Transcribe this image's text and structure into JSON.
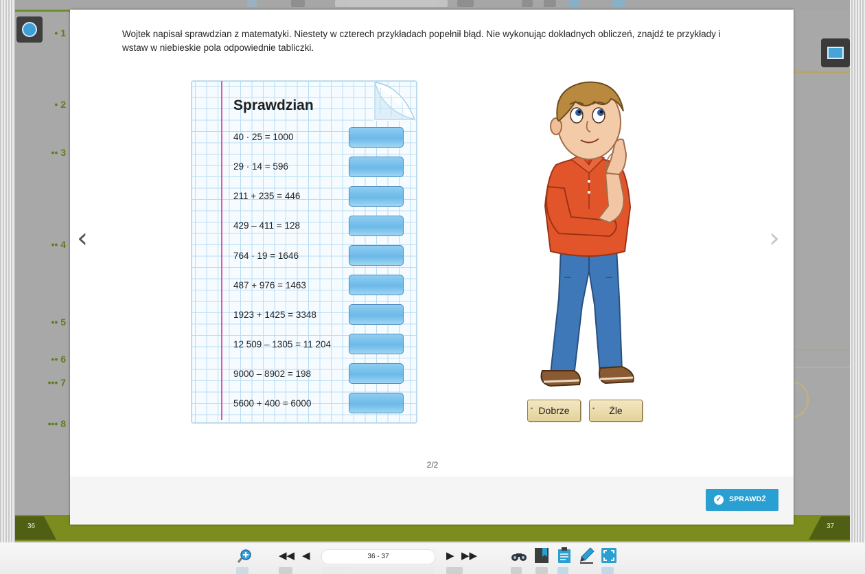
{
  "instruction": "Wojtek napisał sprawdzian z matematyki. Niestety w czterech przykładach popełnił błąd. Nie wykonując dokładnych obliczeń, znajdź te przykłady i wstaw w niebieskie pola odpowiednie tabliczki.",
  "sheet": {
    "title": "Sprawdzian",
    "equations": [
      "40 · 25 = 1000",
      "29 · 14 = 596",
      "211 + 235 = 446",
      "429 – 411 = 128",
      "764 · 19 = 1646",
      "487 + 976 = 1463",
      "1923 + 1425 = 3348",
      "12 509 – 1305 = 11 204",
      "9000 – 8902 = 198",
      "5600 + 400 = 6000"
    ]
  },
  "tiles": {
    "good": "Dobrze",
    "bad": "Źle"
  },
  "page_indicator": "2/2",
  "check_button": "SPRAWDŹ",
  "book": {
    "left_page": "36",
    "right_page": "37",
    "side_numbers": [
      "• 1",
      "• 2",
      "•• 3",
      "•• 4",
      "•• 5",
      "•• 6",
      "••• 7",
      "••• 8"
    ]
  },
  "toolbar": {
    "page_range": "36 - 37",
    "icons": [
      "zoom-in-icon",
      "first-page-icon",
      "prev-page-icon",
      "next-page-icon",
      "last-page-icon",
      "binoculars-icon",
      "bookmark-icon",
      "notes-icon",
      "pen-icon",
      "fullscreen-icon"
    ]
  },
  "colors": {
    "accent_green": "#7d8c1f",
    "check_blue": "#2a9fd1",
    "slot_blue": "#6cb9e8",
    "margin_pink": "#d95aa8",
    "icon_blue": "#2a8fd1"
  }
}
